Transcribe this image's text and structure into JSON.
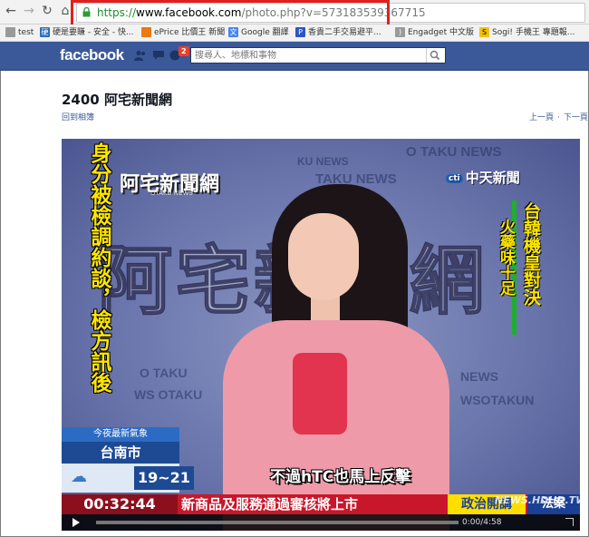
{
  "browser": {
    "url": {
      "scheme": "https://",
      "host": "www.facebook.com",
      "path": "/photo.php?v=573183539367715"
    },
    "bookmarks": [
      {
        "label": "test",
        "icon": "doc-icon",
        "color": "#777777"
      },
      {
        "label": "硬是要賺 - 安全 - 快...",
        "icon": "site-icon",
        "color": "#2a6ebb"
      },
      {
        "label": "ePrice 比價王 新聞",
        "icon": "site-icon",
        "color": "#e87a12"
      },
      {
        "label": "Google 翻譯",
        "icon": "translate-icon",
        "color": "#4285f4"
      },
      {
        "label": "香貴二手交易避平...",
        "icon": "site-icon",
        "color": "#2f55c6"
      },
      {
        "label": "Engadget 中文版",
        "icon": "feed-icon",
        "color": "#777777"
      },
      {
        "label": "Sogi! 手機王 專題報...",
        "icon": "s-icon",
        "color": "#f2c200"
      }
    ]
  },
  "facebook": {
    "logo": "facebook",
    "notification_count": "2",
    "search_placeholder": "搜尋人、地標和事物"
  },
  "page": {
    "title": "2400 阿宅新聞網",
    "back_link": "回到相簿",
    "prev_link": "上一頁",
    "separator": "·",
    "next_link": "下一頁"
  },
  "video": {
    "left_caption": "身分被檢調約談，檢方訊後",
    "show_logo": "阿宅新聞網",
    "show_logo_sub": "OTAKU NEWS",
    "channel": "中天新聞",
    "channel_prefix": "cti",
    "right_caption_1": "台韓機皇對決",
    "right_caption_2": "火藥味十足",
    "weather_title": "今夜最新氣象",
    "weather_city": "台南市",
    "weather_temp": "19~21",
    "subtitle": "不過hTC也馬上反擊",
    "clock": "00:32:44",
    "ticker_text": "新商品及服務通過審核將上市",
    "ticker_tag": "政治開講",
    "ticker_tag2": "法案",
    "time_display": "0:00/4:58",
    "watermark": "NEWS.HDHD.TW",
    "bg_words": [
      "TAKU NEWS",
      "O TAKU NEWS",
      "KU NEWS",
      "WS OTAKU",
      "NEWS",
      "O TAKU",
      "WSOTAKUN"
    ]
  }
}
